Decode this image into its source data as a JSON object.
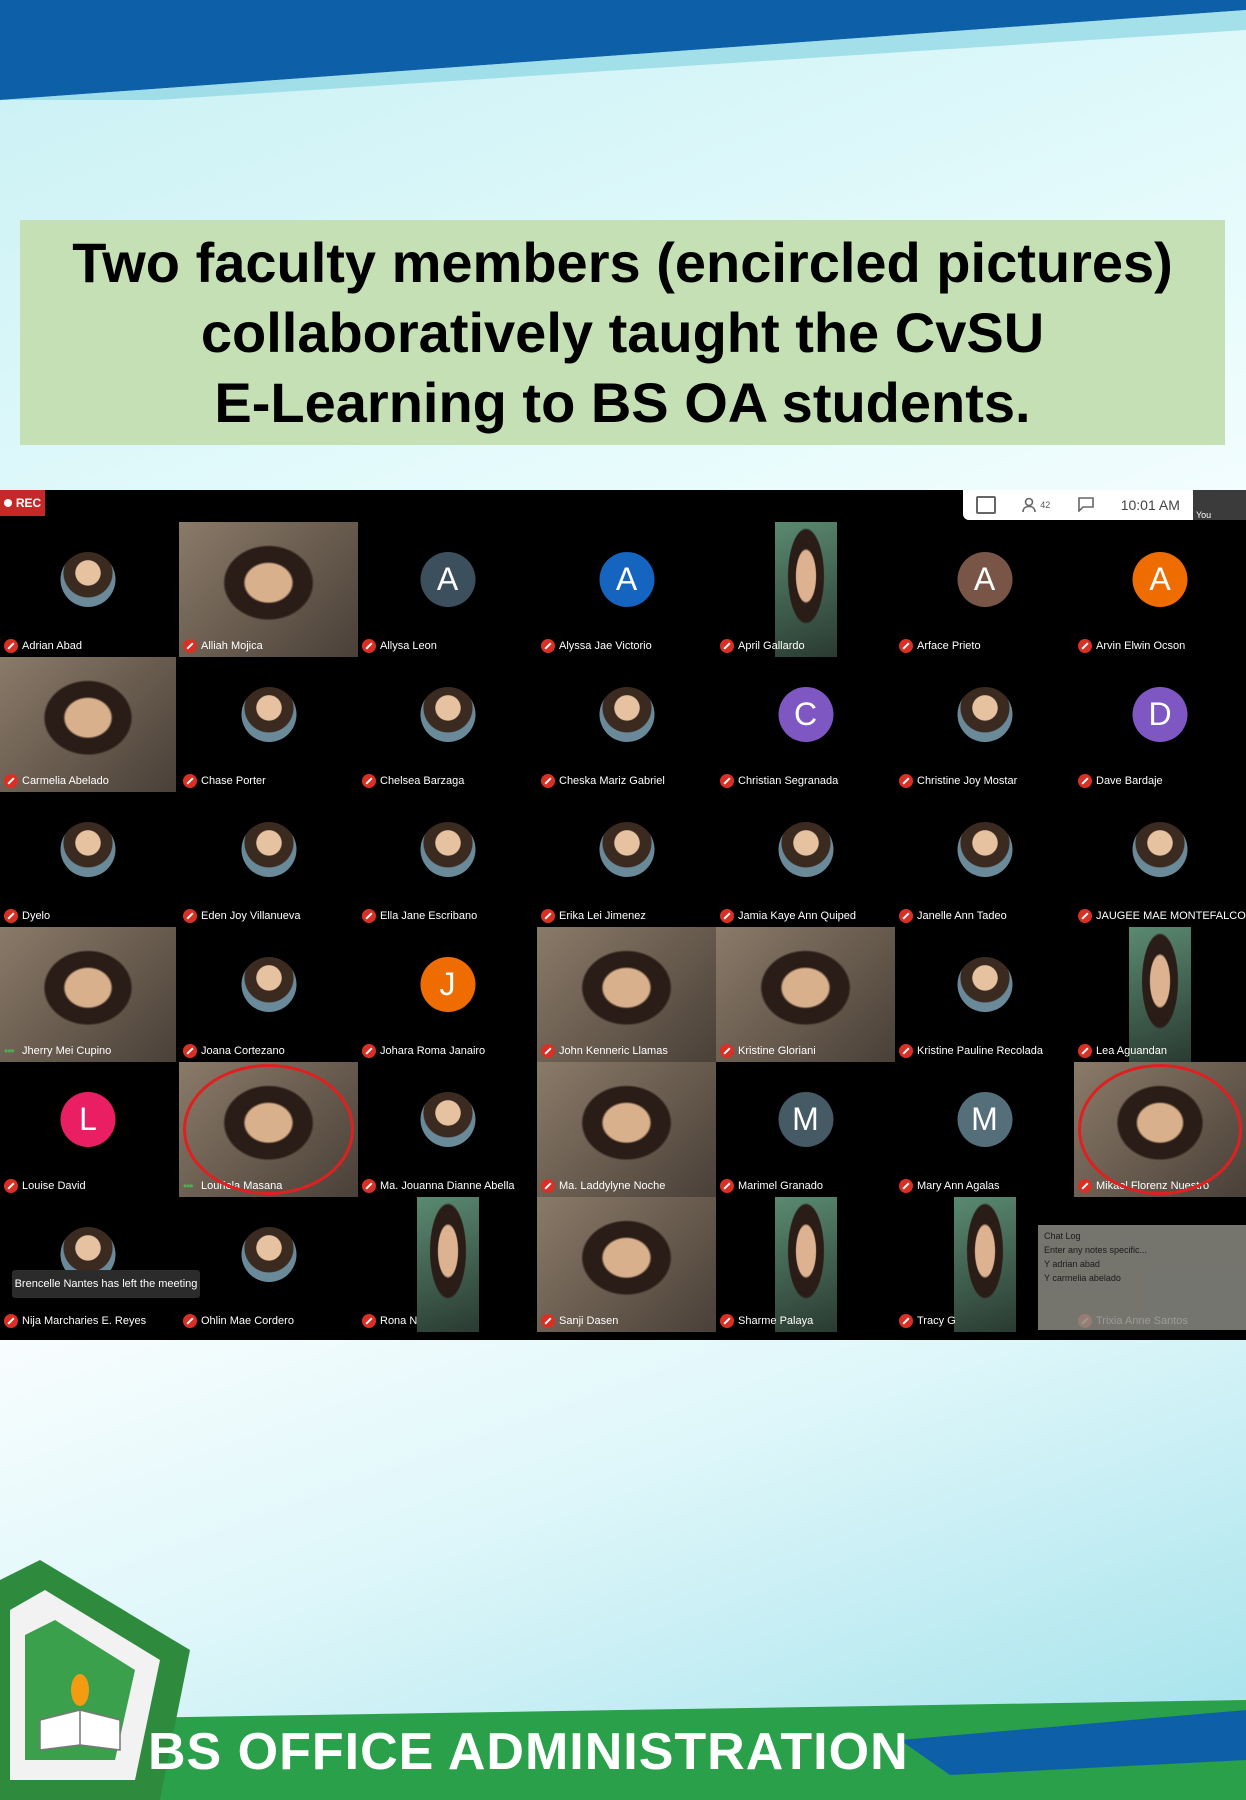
{
  "slide": {
    "title_lines": [
      "Two faculty members (encircled pictures)",
      "collaboratively taught the CvSU",
      "E-Learning to BS OA students."
    ],
    "footer": "BS OFFICE ADMINISTRATION",
    "colors": {
      "title_bg": "#c5e0b4",
      "top_band": "#0d5fa8",
      "footer_band": "#2aa04a",
      "highlight_circle": "#e02020"
    }
  },
  "meeting": {
    "rec_label": "REC",
    "time": "10:01 AM",
    "participants_count": "42",
    "you_label": "You",
    "toolbar_icons": [
      "grid-layout-icon",
      "people-icon",
      "chat-icon"
    ],
    "participants": [
      {
        "name": "Adrian Abad",
        "type": "photo-avatar",
        "muted": true
      },
      {
        "name": "Alliah Mojica",
        "type": "video",
        "muted": true
      },
      {
        "name": "Allysa Leon",
        "type": "letter",
        "letter": "A",
        "color": "#3c4f5c",
        "muted": true
      },
      {
        "name": "Alyssa Jae Victorio",
        "type": "letter",
        "letter": "A",
        "color": "#1565c0",
        "muted": true
      },
      {
        "name": "April Gallardo",
        "type": "video-narrow",
        "muted": true
      },
      {
        "name": "Arface Prieto",
        "type": "letter",
        "letter": "A",
        "color": "#795548",
        "muted": true
      },
      {
        "name": "Arvin Elwin Ocson",
        "type": "letter",
        "letter": "A",
        "color": "#ef6c00",
        "muted": true
      },
      {
        "name": "Carmelia Abelado",
        "type": "video",
        "muted": true
      },
      {
        "name": "Chase Porter",
        "type": "photo-avatar",
        "muted": true
      },
      {
        "name": "Chelsea Barzaga",
        "type": "photo-avatar",
        "muted": true
      },
      {
        "name": "Cheska Mariz Gabriel",
        "type": "photo-avatar",
        "muted": true
      },
      {
        "name": "Christian Segranada",
        "type": "letter",
        "letter": "C",
        "color": "#7e57c2",
        "muted": true
      },
      {
        "name": "Christine Joy Mostar",
        "type": "photo-avatar",
        "muted": true
      },
      {
        "name": "Dave Bardaje",
        "type": "letter",
        "letter": "D",
        "color": "#7e57c2",
        "muted": true
      },
      {
        "name": "Dyelo",
        "type": "photo-avatar",
        "muted": true
      },
      {
        "name": "Eden Joy Villanueva",
        "type": "photo-avatar",
        "muted": true
      },
      {
        "name": "Ella Jane Escribano",
        "type": "photo-avatar",
        "muted": true
      },
      {
        "name": "Erika Lei Jimenez",
        "type": "photo-avatar",
        "muted": true
      },
      {
        "name": "Jamia Kaye Ann Quiped",
        "type": "photo-avatar",
        "muted": true
      },
      {
        "name": "Janelle Ann Tadeo",
        "type": "photo-avatar",
        "muted": true
      },
      {
        "name": "JAUGEE MAE MONTEFALCO",
        "type": "photo-avatar",
        "muted": true
      },
      {
        "name": "Jherry Mei Cupino",
        "type": "video",
        "muted": false
      },
      {
        "name": "Joana Cortezano",
        "type": "photo-avatar",
        "muted": true
      },
      {
        "name": "Johara Roma Janairo",
        "type": "letter",
        "letter": "J",
        "color": "#ef6c00",
        "muted": true
      },
      {
        "name": "John Kenneric Llamas",
        "type": "video",
        "muted": true
      },
      {
        "name": "Kristine Gloriani",
        "type": "video",
        "muted": true
      },
      {
        "name": "Kristine Pauline Recolada",
        "type": "photo-avatar",
        "muted": true
      },
      {
        "name": "Lea Aguandan",
        "type": "video-narrow",
        "muted": true
      },
      {
        "name": "Louise David",
        "type": "letter",
        "letter": "L",
        "color": "#e91e63",
        "muted": true
      },
      {
        "name": "Louriela Masana",
        "type": "video",
        "muted": false,
        "encircled": true
      },
      {
        "name": "Ma. Jouanna Dianne Abella",
        "type": "photo-avatar",
        "muted": true
      },
      {
        "name": "Ma. Laddylyne Noche",
        "type": "video",
        "muted": true
      },
      {
        "name": "Marimel Granado",
        "type": "letter",
        "letter": "M",
        "color": "#455a64",
        "muted": true
      },
      {
        "name": "Mary Ann Agalas",
        "type": "letter",
        "letter": "M",
        "color": "#546e7a",
        "muted": true
      },
      {
        "name": "Mikael Florenz Nuestro",
        "type": "video",
        "muted": true,
        "encircled": true
      },
      {
        "name": "Nija Marcharies E. Reyes",
        "type": "photo-avatar",
        "muted": true
      },
      {
        "name": "Ohlin Mae Cordero",
        "type": "photo-avatar",
        "muted": true
      },
      {
        "name": "Rona N",
        "type": "video-narrow",
        "muted": true
      },
      {
        "name": "Sanji Dasen",
        "type": "video",
        "muted": true
      },
      {
        "name": "Sharme Palaya",
        "type": "video-narrow",
        "muted": true
      },
      {
        "name": "Tracy G",
        "type": "video-narrow",
        "muted": true
      },
      {
        "name": "Trixia Anne Santos",
        "type": "chat-tile",
        "muted": true
      }
    ],
    "toast": "Brencelle Nantes has left the meeting",
    "chat": {
      "header": "Chat Log",
      "input_placeholder": "Enter any notes specific...",
      "lines": [
        "Y adrian abad",
        "Y carmelia abelado"
      ]
    }
  }
}
